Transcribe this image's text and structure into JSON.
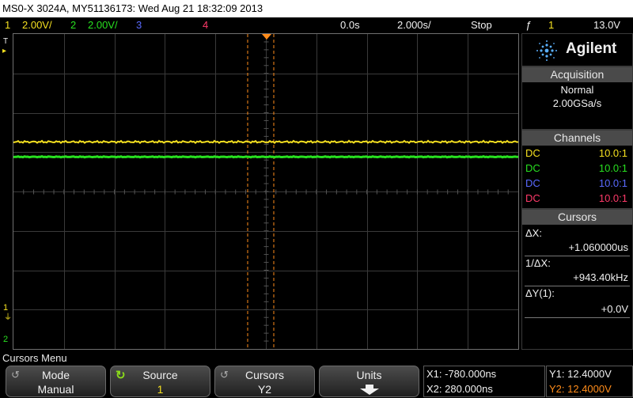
{
  "title": "MS0-X 3024A, MY51136173: Wed Aug 21 18:32:09 2013",
  "status": {
    "ch1": {
      "num": "1",
      "scale": "2.00V/",
      "color": "#f5e020"
    },
    "ch2": {
      "num": "2",
      "scale": "2.00V/",
      "color": "#28e020"
    },
    "ch3": {
      "num": "3",
      "color": "#5a6aff"
    },
    "ch4": {
      "num": "4",
      "color": "#ff3a6a"
    },
    "time_delay": "0.0s",
    "time_scale": "2.000s/",
    "run_state": "Stop",
    "trigger_symbol": "ƒ",
    "trigger_source": "1",
    "trigger_level": "13.0V"
  },
  "graticule": {
    "trigger_marker": "T",
    "ch1_marker": "1",
    "ch2_marker": "2"
  },
  "panel": {
    "brand": "Agilent",
    "acquisition": {
      "header": "Acquisition",
      "mode": "Normal",
      "rate": "2.00GSa/s"
    },
    "channels": {
      "header": "Channels",
      "rows": [
        {
          "coupling": "DC",
          "probe": "10.0:1",
          "color": "#f5e020"
        },
        {
          "coupling": "DC",
          "probe": "10.0:1",
          "color": "#28e020"
        },
        {
          "coupling": "DC",
          "probe": "10.0:1",
          "color": "#5a6aff"
        },
        {
          "coupling": "DC",
          "probe": "10.0:1",
          "color": "#ff3a6a"
        }
      ]
    },
    "cursors": {
      "header": "Cursors",
      "dx_label": "ΔX:",
      "dx_value": "+1.060000us",
      "inv_dx_label": "1/ΔX:",
      "inv_dx_value": "+943.40kHz",
      "dy_label": "ΔY(1):",
      "dy_value": "+0.0V"
    }
  },
  "menu": {
    "title": "Cursors Menu",
    "softkeys": [
      {
        "top": "Mode",
        "bottom": "Manual"
      },
      {
        "top": "Source",
        "bottom": "1"
      },
      {
        "top": "Cursors",
        "bottom": "Y2"
      },
      {
        "top": "Units",
        "bottom": ""
      }
    ]
  },
  "readouts": {
    "x1": "X1: -780.000ns",
    "x2": "X2: 280.000ns",
    "y1": "Y1: 12.4000V",
    "y2": "Y2: 12.4000V",
    "cursor_color": "#ff8c1a"
  },
  "traces": {
    "ch1_level": 1.26,
    "ch2_level": 0.88
  }
}
